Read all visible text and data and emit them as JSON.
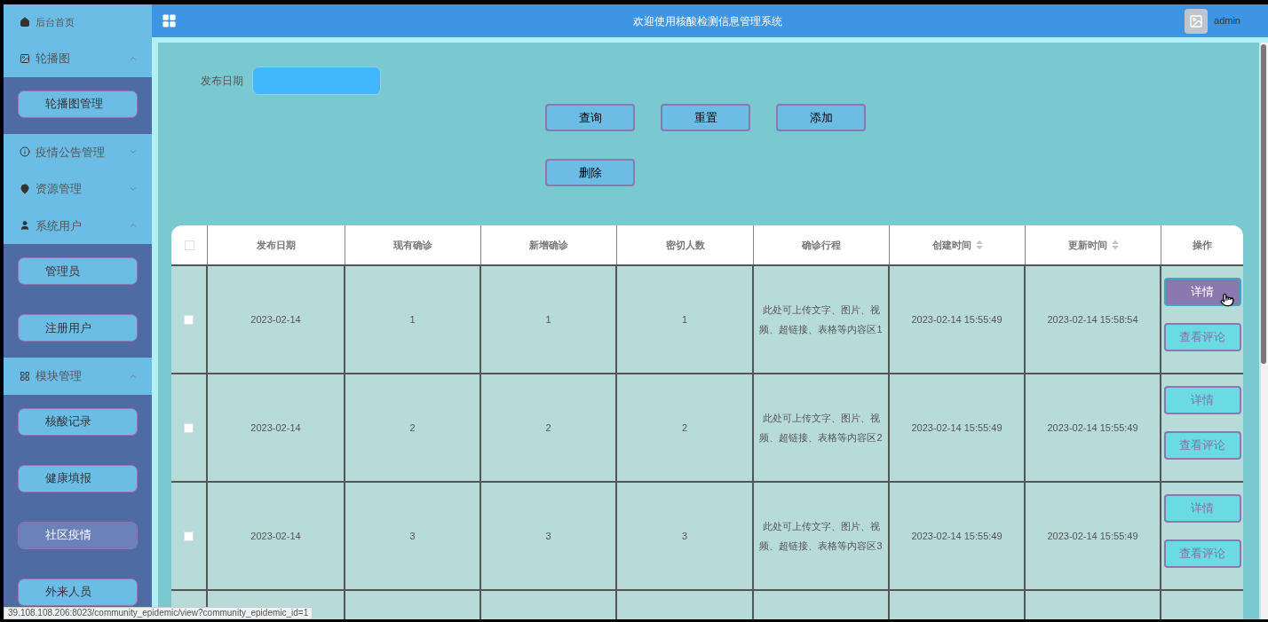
{
  "header": {
    "title": "欢迎使用核酸检测信息管理系统",
    "user": "admin"
  },
  "sidebar": {
    "items": [
      {
        "label": "后台首页"
      },
      {
        "label": "轮播图",
        "expanded": true,
        "children": [
          {
            "label": "轮播图管理",
            "selected": false
          }
        ]
      },
      {
        "label": "疫情公告管理",
        "expanded": false
      },
      {
        "label": "资源管理",
        "expanded": false
      },
      {
        "label": "系统用户",
        "expanded": true,
        "children": [
          {
            "label": "管理员",
            "selected": false
          },
          {
            "label": "注册用户",
            "selected": false
          }
        ]
      },
      {
        "label": "模块管理",
        "expanded": true,
        "children": [
          {
            "label": "核酸记录",
            "selected": false
          },
          {
            "label": "健康填报",
            "selected": false
          },
          {
            "label": "社区疫情",
            "selected": true
          },
          {
            "label": "外来人员",
            "selected": false
          }
        ]
      }
    ]
  },
  "filter": {
    "label": "发布日期"
  },
  "actions": [
    "查询",
    "重置",
    "添加",
    "删除"
  ],
  "table": {
    "all_checked": false,
    "columns": [
      {
        "label": "发布日期",
        "sortable": false
      },
      {
        "label": "现有确诊",
        "sortable": false
      },
      {
        "label": "新增确诊",
        "sortable": false
      },
      {
        "label": "密切人数",
        "sortable": false
      },
      {
        "label": "确诊行程",
        "sortable": false
      },
      {
        "label": "创建时间",
        "sortable": true
      },
      {
        "label": "更新时间",
        "sortable": true
      },
      {
        "label": "操作",
        "sortable": false
      }
    ],
    "rows": [
      {
        "checked": false,
        "cells": [
          "2023-02-14",
          "1",
          "1",
          "1",
          "此处可上传文字、图片、视频、超链接、表格等内容区1",
          "2023-02-14 15:55:49",
          "2023-02-14 15:58:54"
        ],
        "buttons": [
          {
            "label": "详情",
            "hovered": true
          },
          {
            "label": "查看评论",
            "hovered": false
          }
        ]
      },
      {
        "checked": false,
        "cells": [
          "2023-02-14",
          "2",
          "2",
          "2",
          "此处可上传文字、图片、视频、超链接、表格等内容区2",
          "2023-02-14 15:55:49",
          "2023-02-14 15:55:49"
        ],
        "buttons": [
          {
            "label": "详情",
            "hovered": false
          },
          {
            "label": "查看评论",
            "hovered": false
          }
        ]
      },
      {
        "checked": false,
        "cells": [
          "2023-02-14",
          "3",
          "3",
          "3",
          "此处可上传文字、图片、视频、超链接、表格等内容区3",
          "2023-02-14 15:55:49",
          "2023-02-14 15:55:49"
        ],
        "buttons": [
          {
            "label": "详情",
            "hovered": false
          },
          {
            "label": "查看评论",
            "hovered": false
          }
        ]
      }
    ]
  },
  "status_bar": "39.108.108.206:8023/community_epidemic/view?community_epidemic_id=1"
}
